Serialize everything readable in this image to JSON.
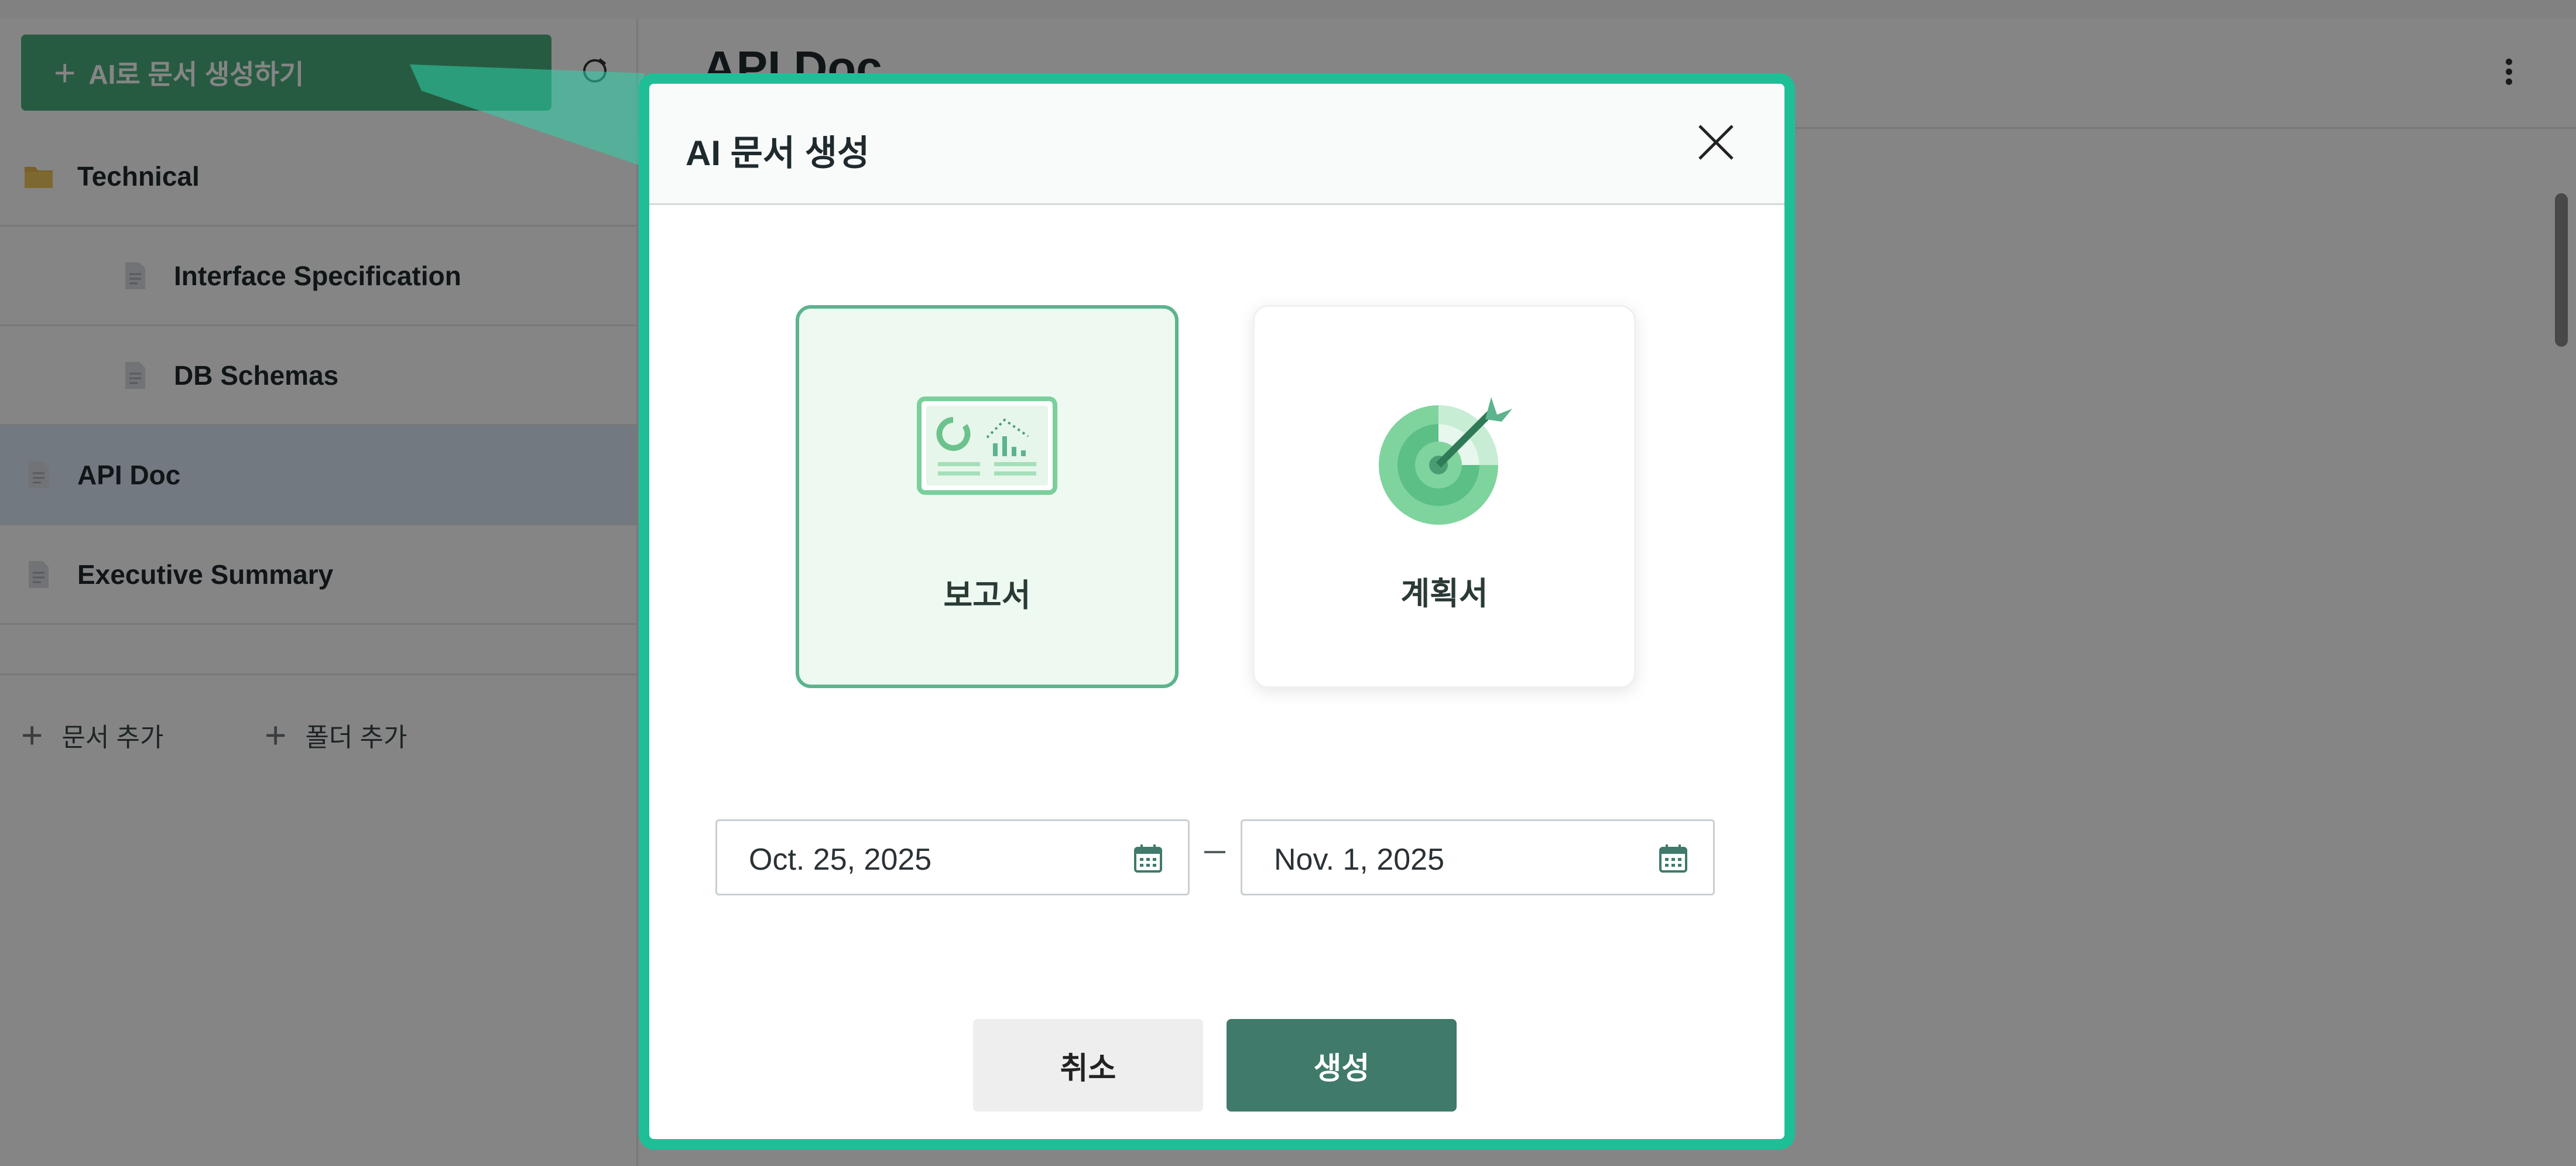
{
  "sidebar": {
    "ai_button_label": "AI로 문서 생성하기",
    "items": [
      {
        "label": "Technical",
        "icon": "folder-icon"
      },
      {
        "label": "Interface Specification",
        "icon": "document-icon"
      },
      {
        "label": "DB Schemas",
        "icon": "document-icon"
      },
      {
        "label": "API Doc",
        "icon": "document-icon",
        "selected": true
      },
      {
        "label": "Executive Summary",
        "icon": "document-icon"
      }
    ],
    "add_document_label": "문서 추가",
    "add_folder_label": "폴더 추가"
  },
  "main": {
    "title": "API Doc"
  },
  "modal": {
    "title": "AI 문서 생성",
    "types": [
      {
        "label": "보고서",
        "icon": "report-dashboard-icon",
        "selected": true
      },
      {
        "label": "계획서",
        "icon": "target-icon",
        "selected": false
      }
    ],
    "start_date": "Oct. 25, 2025",
    "end_date": "Nov. 1, 2025",
    "cancel_label": "취소",
    "create_label": "생성"
  },
  "colors": {
    "accent": "#1ebf97",
    "primary_button": "#3f7a6a",
    "ai_button": "#4caf7d",
    "selected_card_bg": "#eefaf1"
  }
}
